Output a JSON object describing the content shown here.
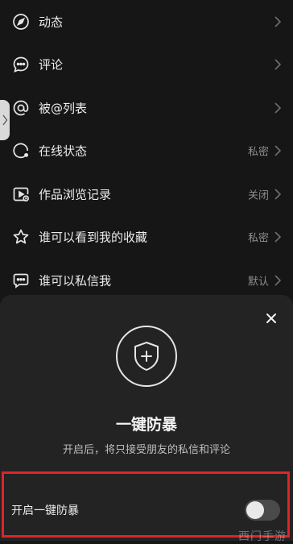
{
  "settings": {
    "items": [
      {
        "label": "动态",
        "value": "",
        "icon": "compass-icon"
      },
      {
        "label": "评论",
        "value": "",
        "icon": "comment-bubble-icon"
      },
      {
        "label": "被@列表",
        "value": "",
        "icon": "at-sign-icon"
      },
      {
        "label": "在线状态",
        "value": "私密",
        "icon": "online-status-icon"
      },
      {
        "label": "作品浏览记录",
        "value": "关闭",
        "icon": "play-history-icon"
      },
      {
        "label": "谁可以看到我的收藏",
        "value": "私密",
        "icon": "star-icon"
      },
      {
        "label": "谁可以私信我",
        "value": "默认",
        "icon": "message-icon"
      }
    ]
  },
  "sheet": {
    "title": "一键防暴",
    "description": "开启后，将只接受朋友的私信和评论",
    "toggle_label": "开启一键防暴",
    "toggle_on": false
  },
  "watermark": "西门手游",
  "colors": {
    "background": "#161616",
    "sheet": "#232323",
    "highlight": "#e0232a"
  }
}
